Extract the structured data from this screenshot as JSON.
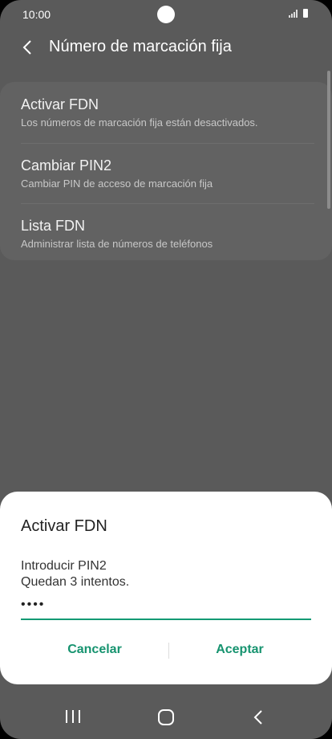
{
  "status_bar": {
    "time": "10:00"
  },
  "header": {
    "title": "Número de marcación fija"
  },
  "settings": {
    "items": [
      {
        "title": "Activar FDN",
        "subtitle": "Los números de marcación fija están desactivados."
      },
      {
        "title": "Cambiar PIN2",
        "subtitle": "Cambiar PIN de acceso de marcación fija"
      },
      {
        "title": "Lista FDN",
        "subtitle": "Administrar lista de números de teléfonos"
      }
    ]
  },
  "dialog": {
    "title": "Activar FDN",
    "prompt": "Introducir PIN2",
    "attempts": "Quedan 3 intentos.",
    "pin_value": "••••",
    "cancel_label": "Cancelar",
    "accept_label": "Aceptar"
  },
  "colors": {
    "accent": "#16936f",
    "overlay_bg": "#5a5a5a",
    "dialog_bg": "#ffffff"
  },
  "icons": {
    "back": "back-arrow-icon",
    "recents": "recents-icon",
    "home": "home-icon",
    "nav_back": "nav-back-icon"
  }
}
